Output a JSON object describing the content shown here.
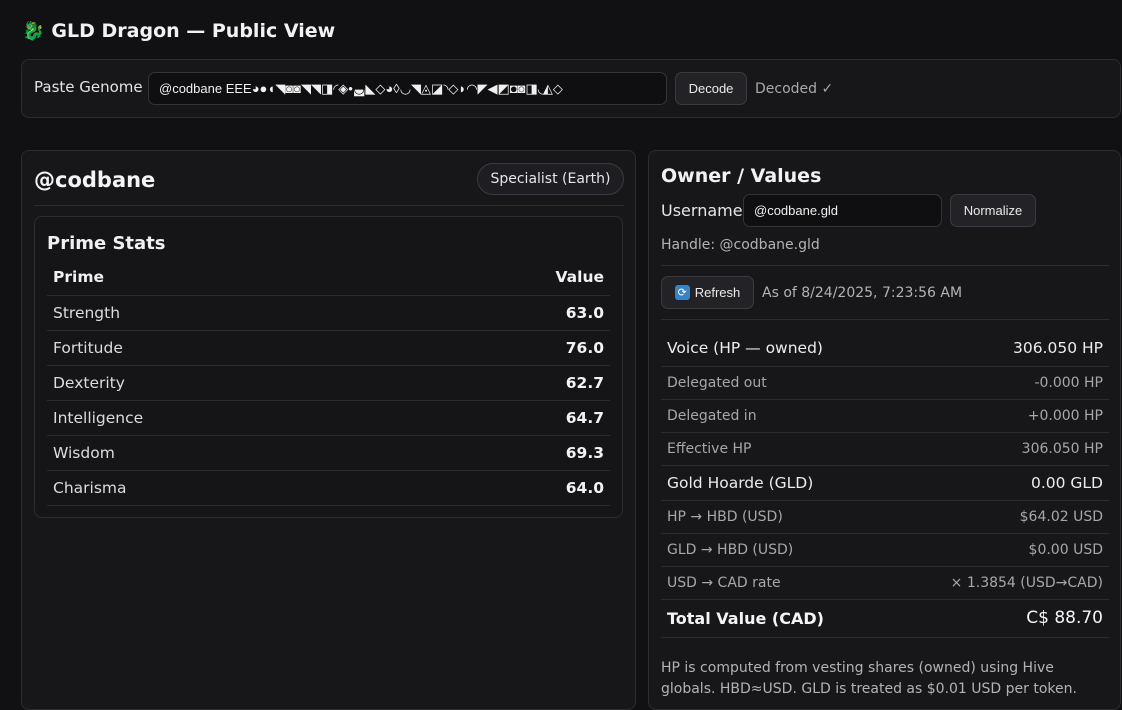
{
  "header": {
    "icon": "dragon-icon",
    "title": "GLD Dragon — Public View"
  },
  "genome": {
    "label": "Paste Genome",
    "value": "@codbane EEE◕●◖◥◙◙◥◥◨◜◈•◛◣◇◕◊◡◥◬◪◝◇◗◠◤◀◩◘◙◨◟◭◇",
    "decode_label": "Decode",
    "status": "Decoded ✓"
  },
  "profile": {
    "name": "@codbane",
    "class_badge": "Specialist (Earth)",
    "stats_title": "Prime Stats",
    "columns": [
      "Prime",
      "Value"
    ],
    "stats": [
      {
        "prime": "Strength",
        "value": "63.0"
      },
      {
        "prime": "Fortitude",
        "value": "76.0"
      },
      {
        "prime": "Dexterity",
        "value": "62.7"
      },
      {
        "prime": "Intelligence",
        "value": "64.7"
      },
      {
        "prime": "Wisdom",
        "value": "69.3"
      },
      {
        "prime": "Charisma",
        "value": "64.0"
      }
    ]
  },
  "owner": {
    "title": "Owner / Values",
    "username_label": "Username",
    "username_value": "@codbane.gld",
    "normalize_label": "Normalize",
    "handle": "Handle: @codbane.gld",
    "refresh_label": "Refresh",
    "refresh_icon": "refresh-icon",
    "as_of": "As of 8/24/2025, 7:23:56 AM",
    "rows": [
      {
        "label": "Voice (HP — owned)",
        "value": "306.050 HP",
        "kind": "major"
      },
      {
        "label": "Delegated out",
        "value": "-0.000 HP",
        "kind": "minor"
      },
      {
        "label": "Delegated in",
        "value": "+0.000 HP",
        "kind": "minor"
      },
      {
        "label": "Effective HP",
        "value": "306.050 HP",
        "kind": "minor"
      },
      {
        "label": "Gold Hoarde (GLD)",
        "value": "0.00 GLD",
        "kind": "major"
      },
      {
        "label": "HP → HBD (USD)",
        "value": "$64.02 USD",
        "kind": "minor"
      },
      {
        "label": "GLD → HBD (USD)",
        "value": "$0.00 USD",
        "kind": "minor"
      },
      {
        "label": "USD → CAD rate",
        "value": "× 1.3854 (USD→CAD)",
        "kind": "minor"
      },
      {
        "label": "Total Value (CAD)",
        "value": "C$ 88.70",
        "kind": "total"
      }
    ],
    "footnote": "HP is computed from vesting shares (owned) using Hive globals. HBD≈USD. GLD is treated as $0.01 USD per token."
  }
}
